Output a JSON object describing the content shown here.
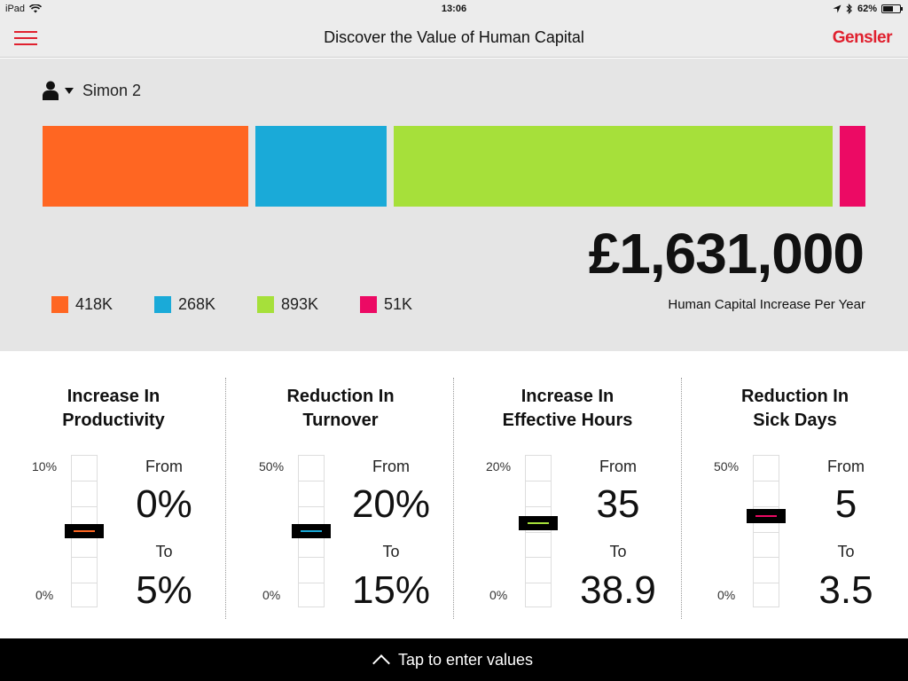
{
  "status_bar": {
    "device": "iPad",
    "time": "13:06",
    "battery": "62%",
    "battery_level": 0.62
  },
  "nav": {
    "title": "Discover the Value of Human Capital",
    "brand": "Gensler"
  },
  "user": {
    "name": "Simon 2"
  },
  "summary": {
    "total": "£1,631,000",
    "subtitle": "Human Capital Increase Per Year",
    "segments": [
      {
        "label": "418K",
        "value": 418,
        "color": "#ff6622"
      },
      {
        "label": "268K",
        "value": 268,
        "color": "#1aaad8"
      },
      {
        "label": "893K",
        "value": 893,
        "color": "#a6e03a"
      },
      {
        "label": "51K",
        "value": 51,
        "color": "#ec0a64"
      }
    ]
  },
  "metrics": [
    {
      "title_line1": "Increase In",
      "title_line2": "Productivity",
      "scale_max": "10%",
      "scale_min": "0%",
      "from_label": "From",
      "from_value": "0%",
      "to_label": "To",
      "to_value": "5%",
      "slider_fraction": 0.5,
      "color": "#ff6622"
    },
    {
      "title_line1": "Reduction In",
      "title_line2": "Turnover",
      "scale_max": "50%",
      "scale_min": "0%",
      "from_label": "From",
      "from_value": "20%",
      "to_label": "To",
      "to_value": "15%",
      "slider_fraction": 0.5,
      "color": "#1aaad8"
    },
    {
      "title_line1": "Increase In",
      "title_line2": "Effective Hours",
      "scale_max": "20%",
      "scale_min": "0%",
      "from_label": "From",
      "from_value": "35",
      "to_label": "To",
      "to_value": "38.9",
      "slider_fraction": 0.55,
      "color": "#a6e03a"
    },
    {
      "title_line1": "Reduction In",
      "title_line2": "Sick Days",
      "scale_max": "50%",
      "scale_min": "0%",
      "from_label": "From",
      "from_value": "5",
      "to_label": "To",
      "to_value": "3.5",
      "slider_fraction": 0.6,
      "color": "#ec0a64"
    }
  ],
  "bottom_bar": {
    "label": "Tap to enter values"
  }
}
